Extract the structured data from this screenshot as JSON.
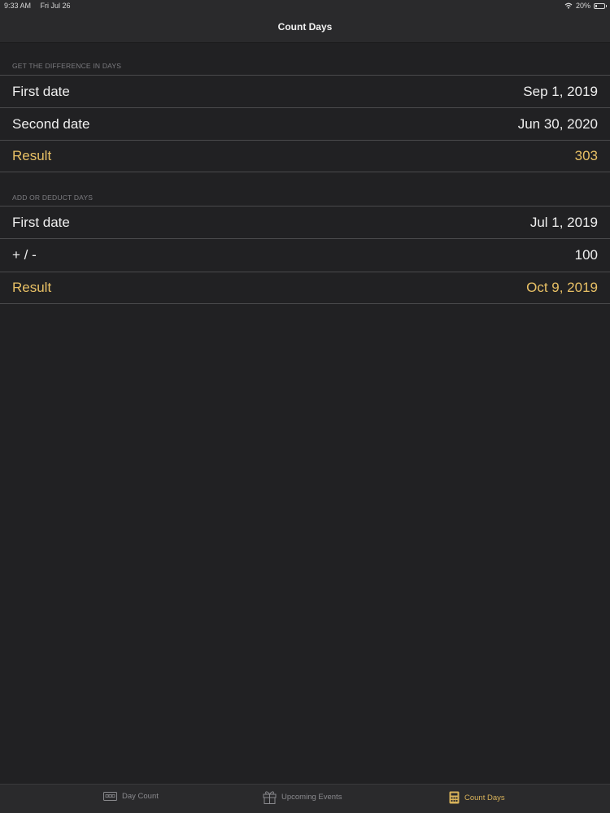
{
  "status_bar": {
    "time": "9:33 AM",
    "date": "Fri Jul 26",
    "battery": "20%"
  },
  "nav": {
    "title": "Count Days"
  },
  "difference_section": {
    "header": "GET THE DIFFERENCE IN DAYS",
    "rows": [
      {
        "label": "First date",
        "value": "Sep 1, 2019"
      },
      {
        "label": "Second date",
        "value": "Jun 30, 2020"
      },
      {
        "label": "Result",
        "value": "303"
      }
    ]
  },
  "add_deduct_section": {
    "header": "ADD OR DEDUCT DAYS",
    "rows": [
      {
        "label": "First date",
        "value": "Jul 1, 2019"
      },
      {
        "label": "+ / -",
        "value": "100"
      },
      {
        "label": "Result",
        "value": "Oct 9, 2019"
      }
    ]
  },
  "tab_bar": {
    "tabs": [
      {
        "label": "Day Count",
        "icon": "ticket-icon"
      },
      {
        "label": "Upcoming Events",
        "icon": "gift-icon"
      },
      {
        "label": "Count Days",
        "icon": "calculator-icon"
      }
    ],
    "active_tab": "Count Days"
  },
  "colors": {
    "accent": "#e8c065",
    "background": "#212123",
    "bar_background": "#2a2a2c"
  }
}
